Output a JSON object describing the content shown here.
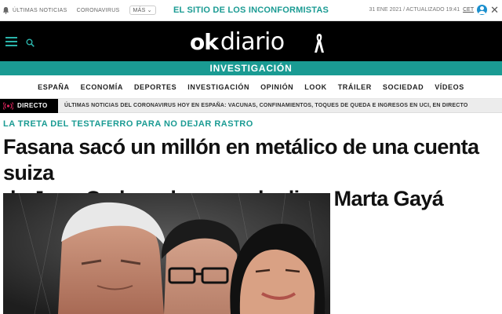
{
  "topbar": {
    "latest_news": "ÚLTIMAS NOTICIAS",
    "coronavirus": "CORONAVIRUS",
    "more_label": "MÁS",
    "tagline": "EL SITIO DE LOS INCONFORMISTAS",
    "datetime": "31 ENE 2021 / ACTUALIZADO 19:41",
    "timezone": "CET"
  },
  "header": {
    "logo_ok": "ok",
    "logo_diario": "diario"
  },
  "section": {
    "title": "INVESTIGACIÓN"
  },
  "nav": {
    "items": [
      "ESPAÑA",
      "ECONOMÍA",
      "DEPORTES",
      "INVESTIGACIÓN",
      "OPINIÓN",
      "LOOK",
      "TRÁILER",
      "SOCIEDAD",
      "VÍDEOS"
    ]
  },
  "live": {
    "tag": "DIRECTO",
    "text": "ÚLTIMAS NOTICIAS DEL CORONAVIRUS HOY EN ESPAÑA: VACUNAS, CONFINAMIENTOS, TOQUES DE QUEDA E INGRESOS EN UCI, EN DIRECTO"
  },
  "article": {
    "kicker": "LA TRETA DEL TESTAFERRO PARA NO DEJAR RASTRO",
    "headline_line1": "Fasana sacó un millón en metálico de una cuenta suiza",
    "headline_line2": "de Juan Carlos y luego se lo dio a Marta Gayá"
  },
  "colors": {
    "brand": "#1a9b93",
    "header_bg": "#000000",
    "live_bg": "#ececec"
  }
}
